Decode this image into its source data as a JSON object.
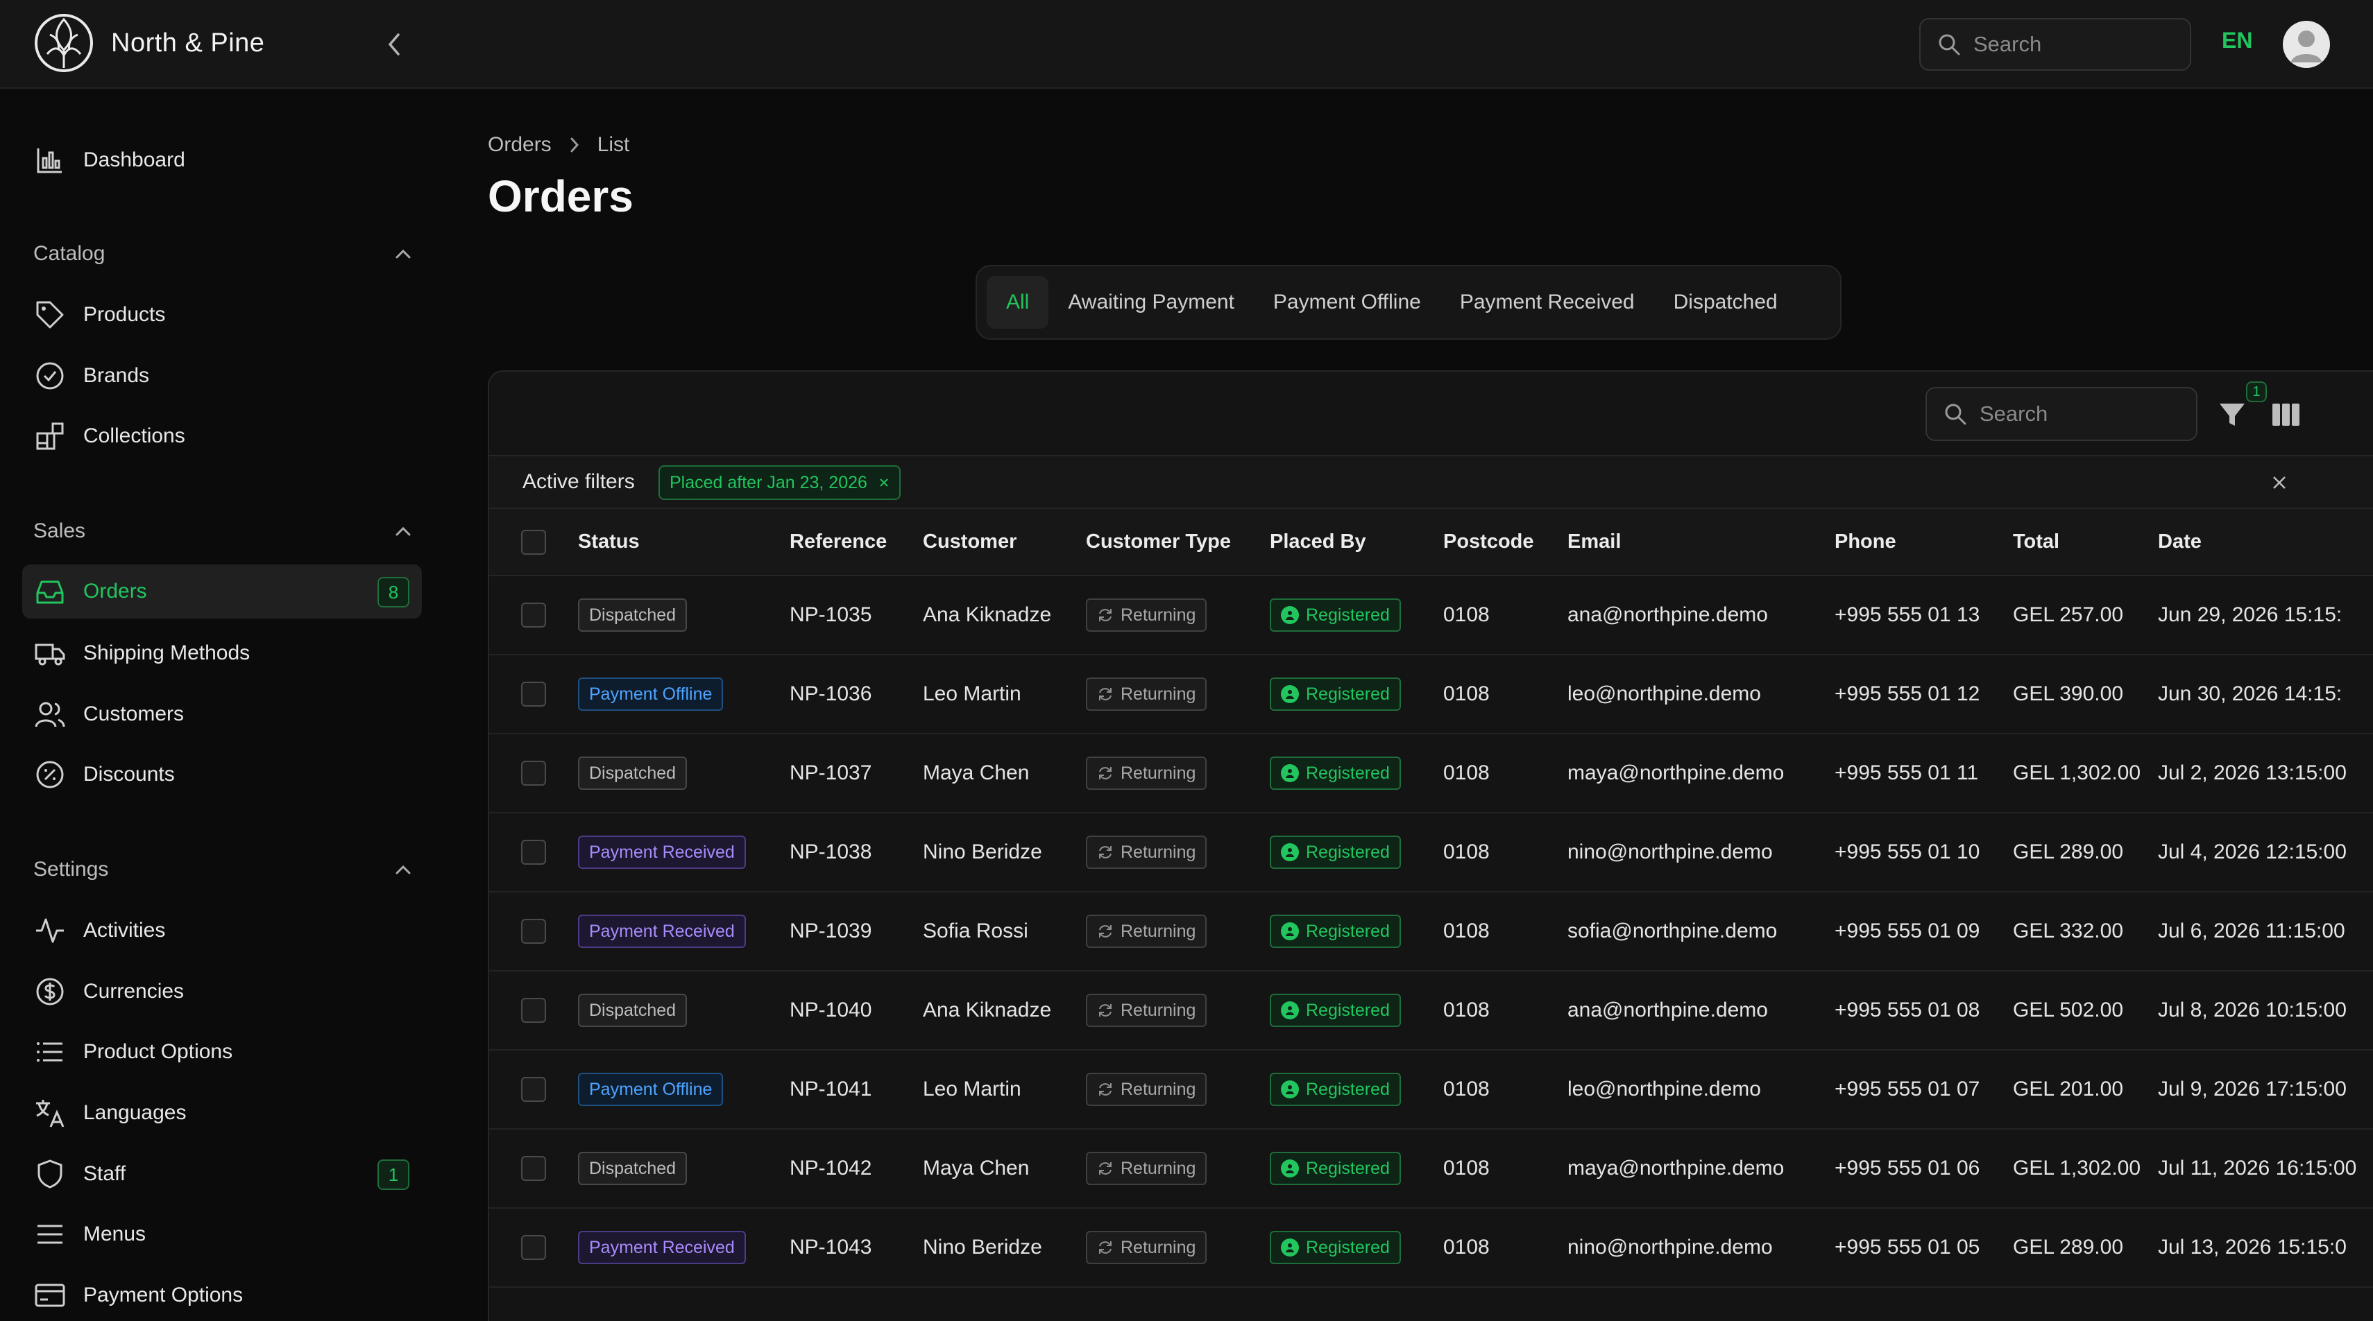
{
  "app": {
    "name": "North & Pine"
  },
  "topbar": {
    "search_placeholder": "Search",
    "language": "EN"
  },
  "sidebar": {
    "dashboard": "Dashboard",
    "catalog": {
      "title": "Catalog",
      "items": [
        "Products",
        "Brands",
        "Collections"
      ]
    },
    "sales": {
      "title": "Sales",
      "items": [
        "Orders",
        "Shipping Methods",
        "Customers",
        "Discounts"
      ],
      "orders_badge": "8"
    },
    "settings": {
      "title": "Settings",
      "items": [
        "Activities",
        "Currencies",
        "Product Options",
        "Languages",
        "Staff",
        "Menus",
        "Payment Options"
      ],
      "staff_badge": "1"
    }
  },
  "breadcrumb": {
    "root": "Orders",
    "current": "List"
  },
  "page": {
    "title": "Orders"
  },
  "tabs": [
    "All",
    "Awaiting Payment",
    "Payment Offline",
    "Payment Received",
    "Dispatched"
  ],
  "table": {
    "search_placeholder": "Search",
    "filter_count": "1",
    "active_filters_label": "Active filters",
    "filter_chip": "Placed after Jan 23, 2026",
    "columns": [
      "Status",
      "Reference",
      "Customer",
      "Customer Type",
      "Placed By",
      "Postcode",
      "Email",
      "Phone",
      "Total",
      "Date"
    ],
    "rows": [
      {
        "status": "Dispatched",
        "status_kind": "dispatched",
        "reference": "NP-1035",
        "customer": "Ana Kiknadze",
        "customer_type": "Returning",
        "placed_by": "Registered",
        "postcode": "0108",
        "email": "ana@northpine.demo",
        "phone": "+995 555 01 13",
        "total": "GEL 257.00",
        "date": "Jun 29, 2026 15:15:"
      },
      {
        "status": "Payment Offline",
        "status_kind": "offline",
        "reference": "NP-1036",
        "customer": "Leo Martin",
        "customer_type": "Returning",
        "placed_by": "Registered",
        "postcode": "0108",
        "email": "leo@northpine.demo",
        "phone": "+995 555 01 12",
        "total": "GEL 390.00",
        "date": "Jun 30, 2026 14:15:"
      },
      {
        "status": "Dispatched",
        "status_kind": "dispatched",
        "reference": "NP-1037",
        "customer": "Maya Chen",
        "customer_type": "Returning",
        "placed_by": "Registered",
        "postcode": "0108",
        "email": "maya@northpine.demo",
        "phone": "+995 555 01 11",
        "total": "GEL 1,302.00",
        "date": "Jul 2, 2026 13:15:00"
      },
      {
        "status": "Payment Received",
        "status_kind": "received",
        "reference": "NP-1038",
        "customer": "Nino Beridze",
        "customer_type": "Returning",
        "placed_by": "Registered",
        "postcode": "0108",
        "email": "nino@northpine.demo",
        "phone": "+995 555 01 10",
        "total": "GEL 289.00",
        "date": "Jul 4, 2026 12:15:00"
      },
      {
        "status": "Payment Received",
        "status_kind": "received",
        "reference": "NP-1039",
        "customer": "Sofia Rossi",
        "customer_type": "Returning",
        "placed_by": "Registered",
        "postcode": "0108",
        "email": "sofia@northpine.demo",
        "phone": "+995 555 01 09",
        "total": "GEL 332.00",
        "date": "Jul 6, 2026 11:15:00"
      },
      {
        "status": "Dispatched",
        "status_kind": "dispatched",
        "reference": "NP-1040",
        "customer": "Ana Kiknadze",
        "customer_type": "Returning",
        "placed_by": "Registered",
        "postcode": "0108",
        "email": "ana@northpine.demo",
        "phone": "+995 555 01 08",
        "total": "GEL 502.00",
        "date": "Jul 8, 2026 10:15:00"
      },
      {
        "status": "Payment Offline",
        "status_kind": "offline",
        "reference": "NP-1041",
        "customer": "Leo Martin",
        "customer_type": "Returning",
        "placed_by": "Registered",
        "postcode": "0108",
        "email": "leo@northpine.demo",
        "phone": "+995 555 01 07",
        "total": "GEL 201.00",
        "date": "Jul 9, 2026 17:15:00"
      },
      {
        "status": "Dispatched",
        "status_kind": "dispatched",
        "reference": "NP-1042",
        "customer": "Maya Chen",
        "customer_type": "Returning",
        "placed_by": "Registered",
        "postcode": "0108",
        "email": "maya@northpine.demo",
        "phone": "+995 555 01 06",
        "total": "GEL 1,302.00",
        "date": "Jul 11, 2026 16:15:00"
      },
      {
        "status": "Payment Received",
        "status_kind": "received",
        "reference": "NP-1043",
        "customer": "Nino Beridze",
        "customer_type": "Returning",
        "placed_by": "Registered",
        "postcode": "0108",
        "email": "nino@northpine.demo",
        "phone": "+995 555 01 05",
        "total": "GEL 289.00",
        "date": "Jul 13, 2026 15:15:0"
      }
    ]
  },
  "colors": {
    "accent": "#22c55e",
    "background": "#0b0b0b",
    "surface": "#141414",
    "offline": "#4ea3ff",
    "received": "#a78bfa"
  },
  "icons": [
    "logo-icon",
    "chevron-left-icon",
    "search-icon",
    "user-avatar-icon",
    "chart-icon",
    "tag-icon",
    "badge-check-icon",
    "collections-icon",
    "inbox-icon",
    "truck-icon",
    "users-icon",
    "percent-icon",
    "activity-icon",
    "dollar-icon",
    "list-icon",
    "translate-icon",
    "shield-icon",
    "menu-icon",
    "credit-card-icon",
    "filter-icon",
    "columns-icon",
    "close-icon",
    "refresh-icon",
    "user-icon"
  ]
}
